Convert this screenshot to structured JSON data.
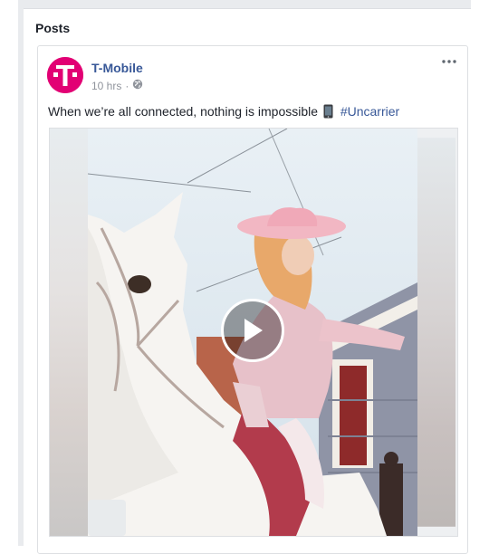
{
  "section": {
    "title": "Posts"
  },
  "post": {
    "author": "T-Mobile",
    "time": "10 hrs",
    "separator": "·",
    "text": "When we’re all connected, nothing is impossible",
    "hashtag": "#Uncarrier",
    "avatar_letter": "T",
    "more_label": "•••"
  },
  "icons": {
    "audience": "globe-icon",
    "phone": "mobile-phone-icon",
    "play": "play-icon",
    "more": "more-options-icon"
  },
  "colors": {
    "brand": "#e20074",
    "link": "#385898",
    "text": "#1d2129",
    "meta": "#90949c"
  }
}
